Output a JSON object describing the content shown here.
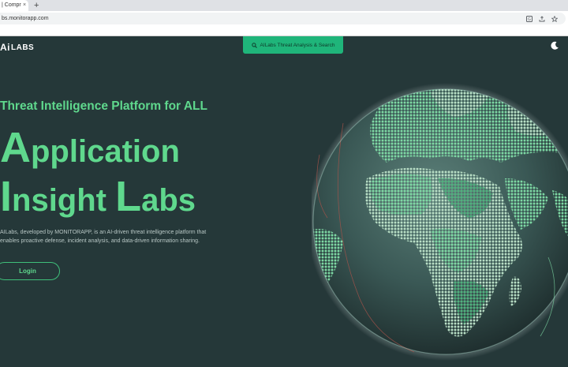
{
  "browser": {
    "tab_title": "| Compr",
    "tab_close": "×",
    "new_tab": "+",
    "url": "bs.monitorapp.com",
    "icons": [
      "translate-icon",
      "share-icon",
      "bookmark-star-icon"
    ]
  },
  "header": {
    "logo_mark": "Ai",
    "logo_text": "LABS",
    "search_label": "AILabs Threat Analysis & Search",
    "theme_icon": "moon-icon"
  },
  "hero": {
    "tagline": "Threat Intelligence Platform for ALL",
    "title_line1_cap": "A",
    "title_line1_rest": "pplication",
    "title_line2_cap": "I",
    "title_line2_mid": "nsight ",
    "title_line2_cap2": "L",
    "title_line2_rest": "abs",
    "description_line1": "AILabs, developed by MONITORAPP, is an AI-driven threat intelligence platform that",
    "description_line2": "enables proactive defense, incident analysis, and data-driven information sharing.",
    "login_label": "Login"
  },
  "colors": {
    "accent": "#5fd88d",
    "search_bg": "#1fb57a",
    "page_bg": "#253839"
  }
}
